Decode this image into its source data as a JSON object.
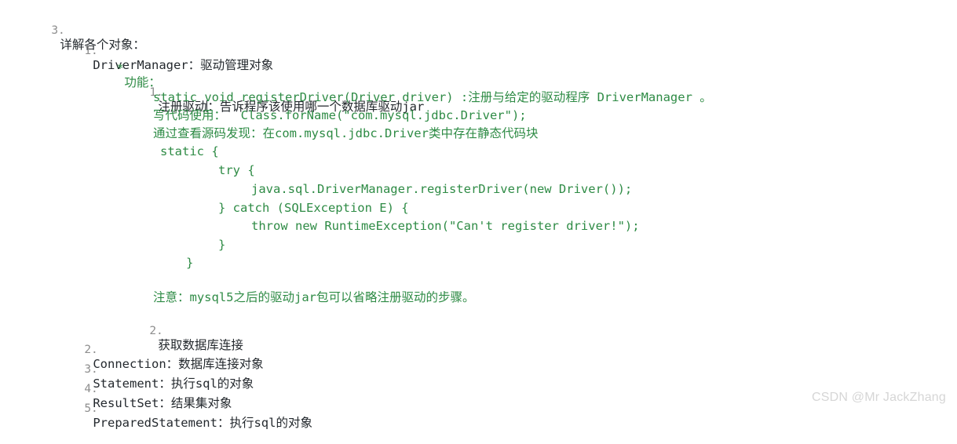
{
  "document": {
    "watermark": "CSDN @Mr JackZhang",
    "lines": [
      {
        "id": "l1",
        "marker": "3.",
        "text": "详解各个对象："
      },
      {
        "id": "l2",
        "marker": "1.",
        "text": "DriverManager：驱动管理对象"
      },
      {
        "id": "l3",
        "marker": "*",
        "text": "功能："
      },
      {
        "id": "l4",
        "marker": "1.",
        "text_before_caret": "注册驱动",
        "text_after_caret": "：告诉程序该使用哪一个数据库驱动jar"
      },
      {
        "id": "l5",
        "text": "static void registerDriver(Driver driver) :注册与给定的驱动程序 DriverManager 。"
      },
      {
        "id": "l6",
        "text": "写代码使用：  Class.forName(\"com.mysql.jdbc.Driver\");"
      },
      {
        "id": "l7",
        "text": "通过查看源码发现：在com.mysql.jdbc.Driver类中存在静态代码块"
      },
      {
        "id": "l8",
        "text": "static {"
      },
      {
        "id": "l9",
        "text": "try {"
      },
      {
        "id": "l10",
        "text": "java.sql.DriverManager.registerDriver(new Driver());"
      },
      {
        "id": "l11",
        "text": "} catch (SQLException E) {"
      },
      {
        "id": "l12",
        "text": "throw new RuntimeException(\"Can't register driver!\");"
      },
      {
        "id": "l13",
        "text": "}"
      },
      {
        "id": "l14",
        "text": "}"
      },
      {
        "id": "l15",
        "text": "注意：mysql5之后的驱动jar包可以省略注册驱动的步骤。"
      },
      {
        "id": "l16",
        "marker": "2.",
        "text": "获取数据库连接"
      },
      {
        "id": "l17",
        "marker": "2.",
        "text": "Connection：数据库连接对象"
      },
      {
        "id": "l18",
        "marker": "3.",
        "text": "Statement：执行sql的对象"
      },
      {
        "id": "l19",
        "marker": "4.",
        "text": "ResultSet：结果集对象"
      },
      {
        "id": "l20",
        "marker": "5.",
        "text": "PreparedStatement：执行sql的对象"
      }
    ],
    "colors": {
      "text_dark": "#24292e",
      "text_green": "#2e8b45",
      "marker_gray": "#8e8e8e",
      "watermark_gray": "#d6d6d6",
      "background": "#ffffff"
    }
  }
}
